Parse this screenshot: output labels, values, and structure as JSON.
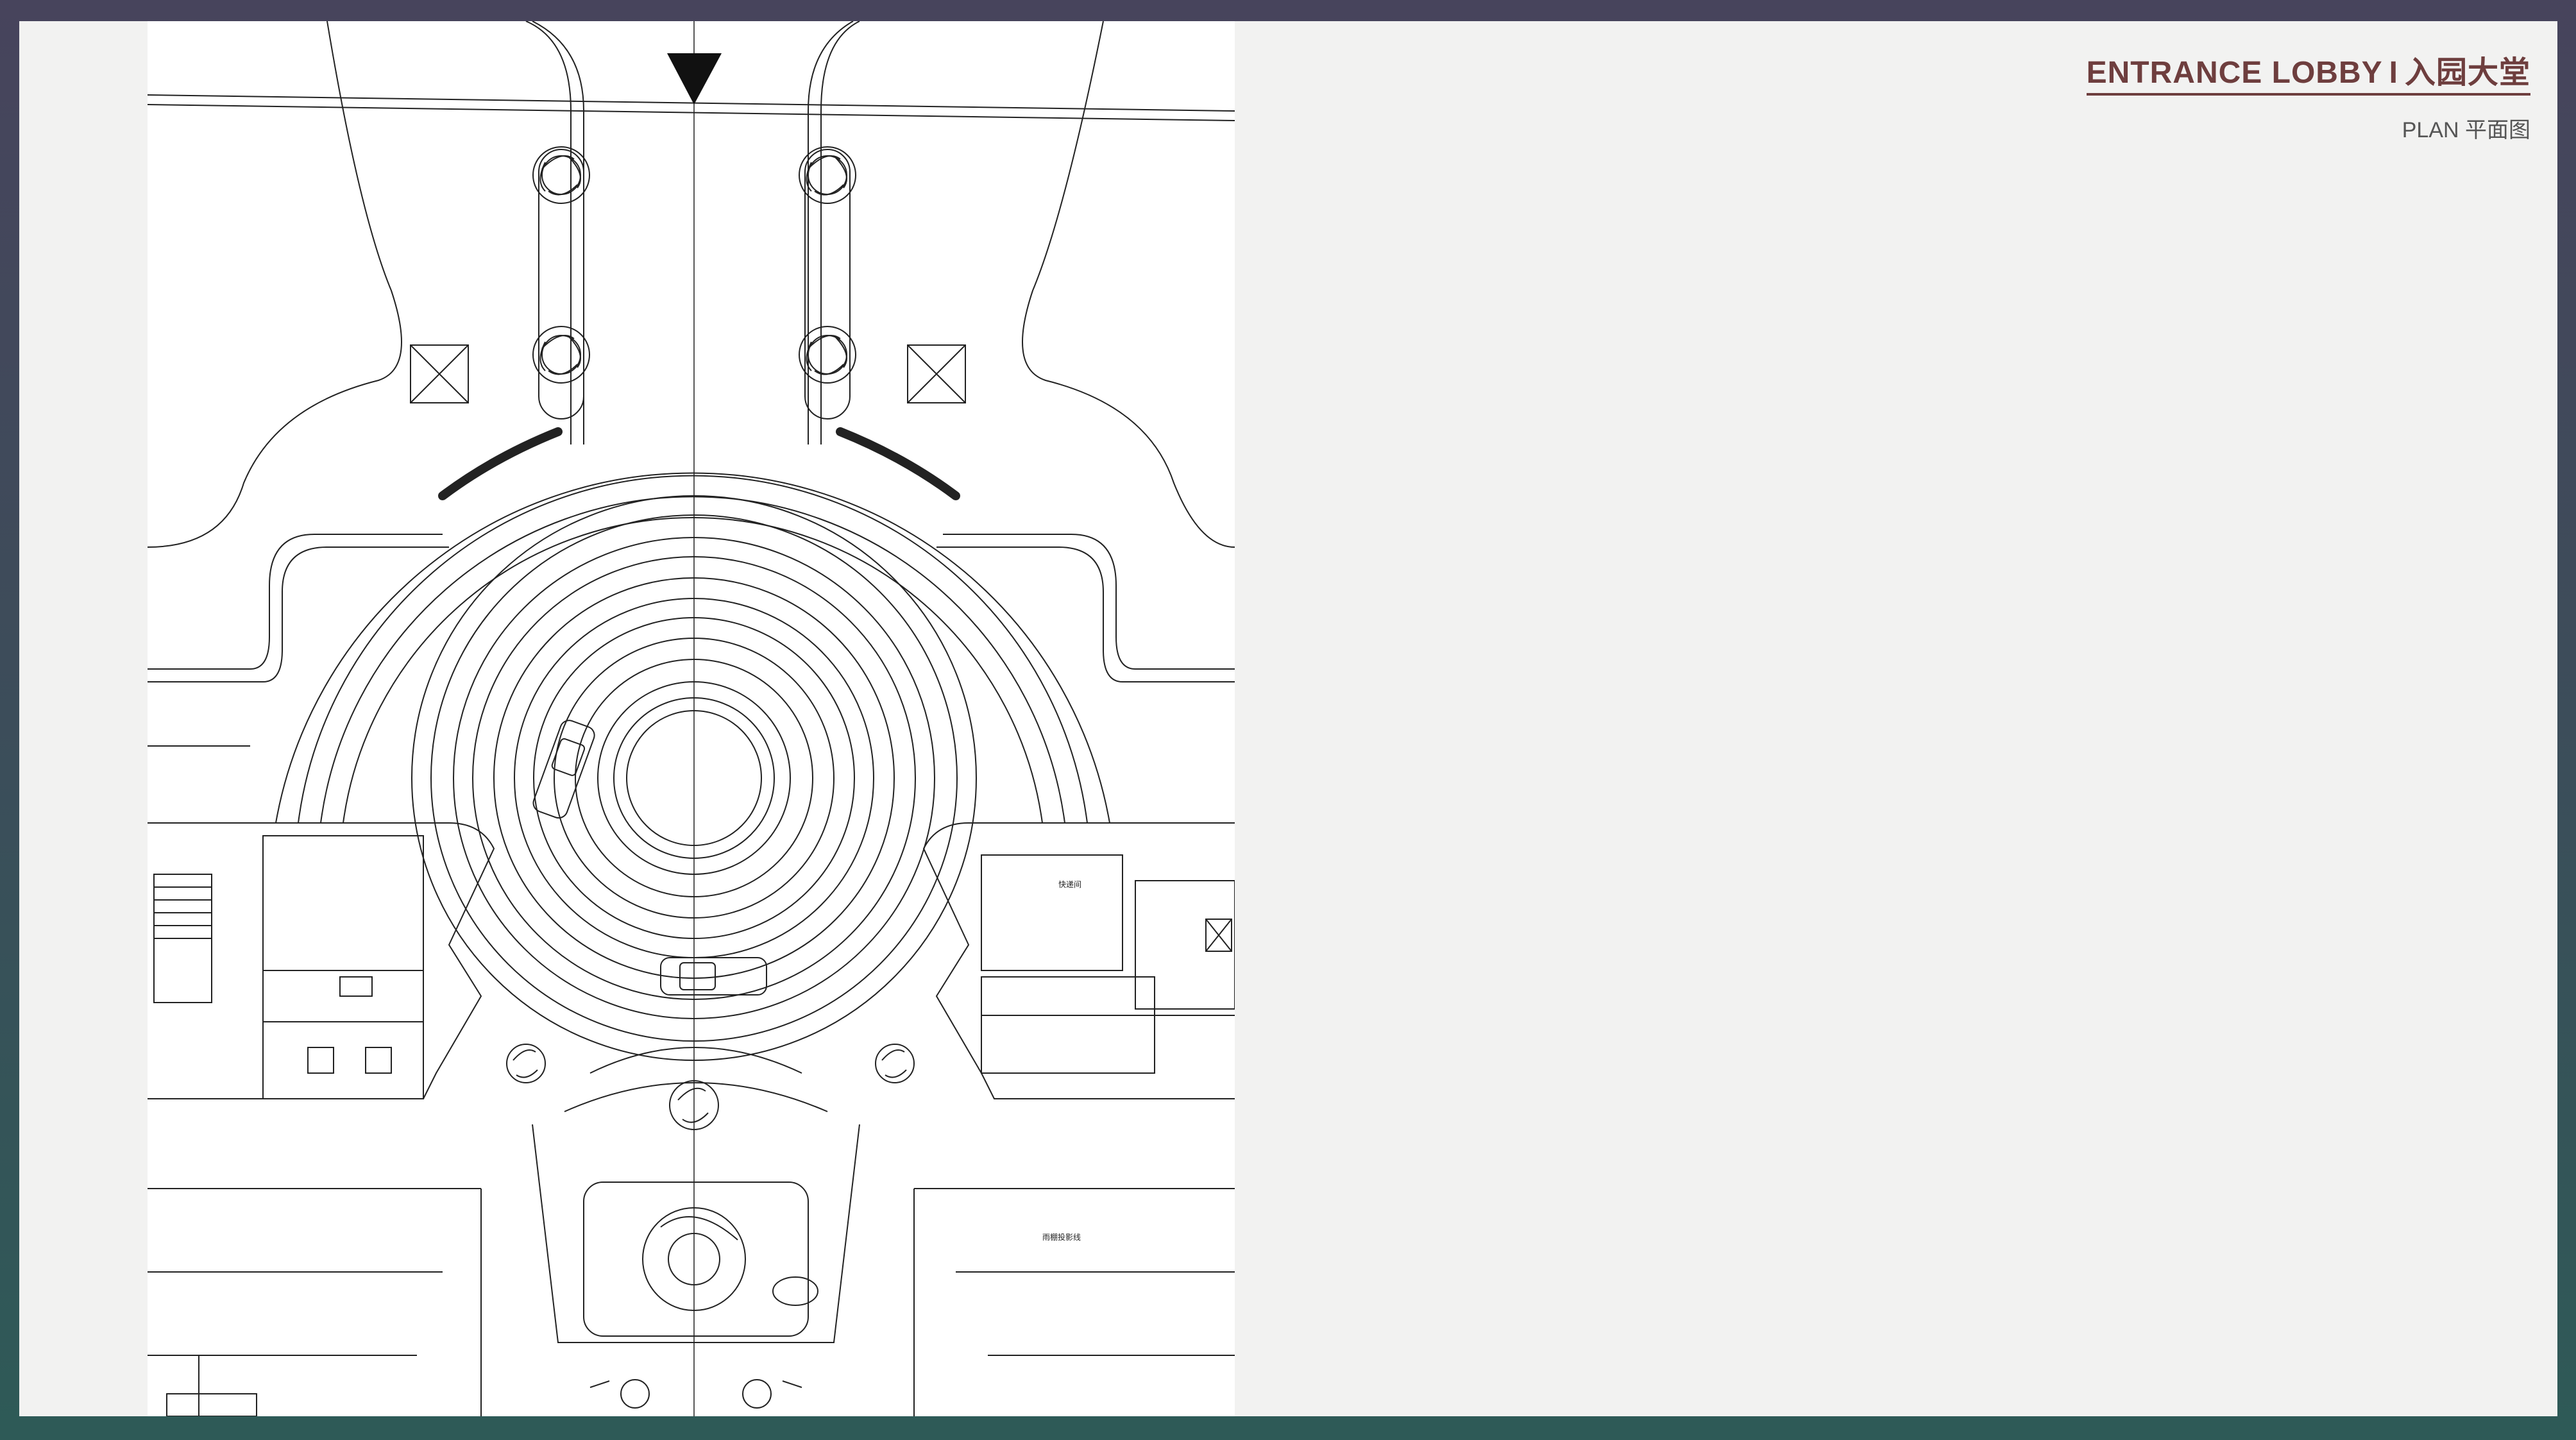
{
  "header": {
    "title_en": "ENTRANCE LOBBY",
    "title_sep": "I",
    "title_cn": "入园大堂",
    "subtitle": "PLAN 平面图"
  },
  "plan": {
    "label_rain": "雨棚投影线",
    "label_room": "快递间"
  },
  "colors": {
    "title": "#6e3e3e",
    "linework": "#222222",
    "sheet": "#f2f2f1"
  }
}
